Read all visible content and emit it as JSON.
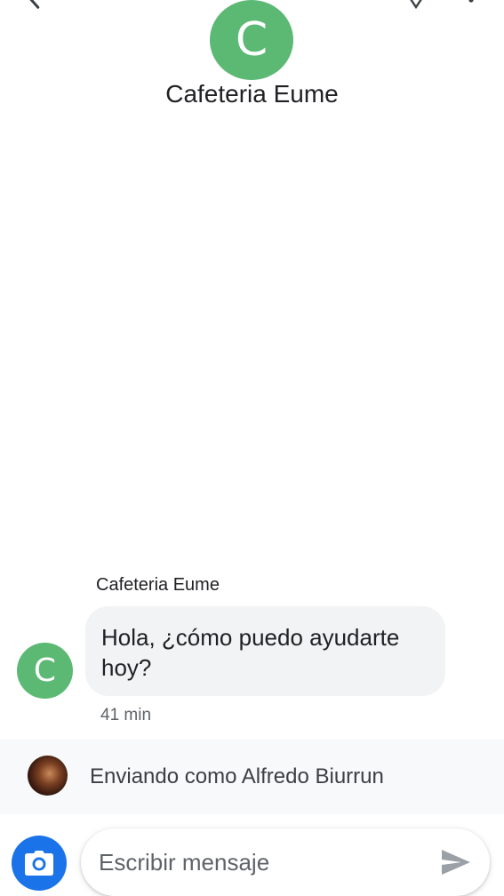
{
  "header": {
    "avatar_letter": "C",
    "title": "Cafeteria Eume",
    "icons": [
      "back-arrow-icon",
      "labs-icon",
      "more-vert-icon"
    ]
  },
  "conversation": {
    "messages": [
      {
        "sender": "Cafeteria Eume",
        "avatar_letter": "C",
        "text_line1": "Hola, ¿cómo puedo ayudarte",
        "text_line2": "hoy?",
        "time": "41 min"
      }
    ]
  },
  "sending": {
    "label": "Enviando como Alfredo Biurrun"
  },
  "composer": {
    "placeholder": "Escribir mensaje",
    "camera_icon": "camera-icon",
    "send_icon": "send-icon"
  },
  "colors": {
    "avatar_green": "#5bb974",
    "accent_blue": "#1a73e8",
    "bubble_bg": "#f1f3f4"
  }
}
